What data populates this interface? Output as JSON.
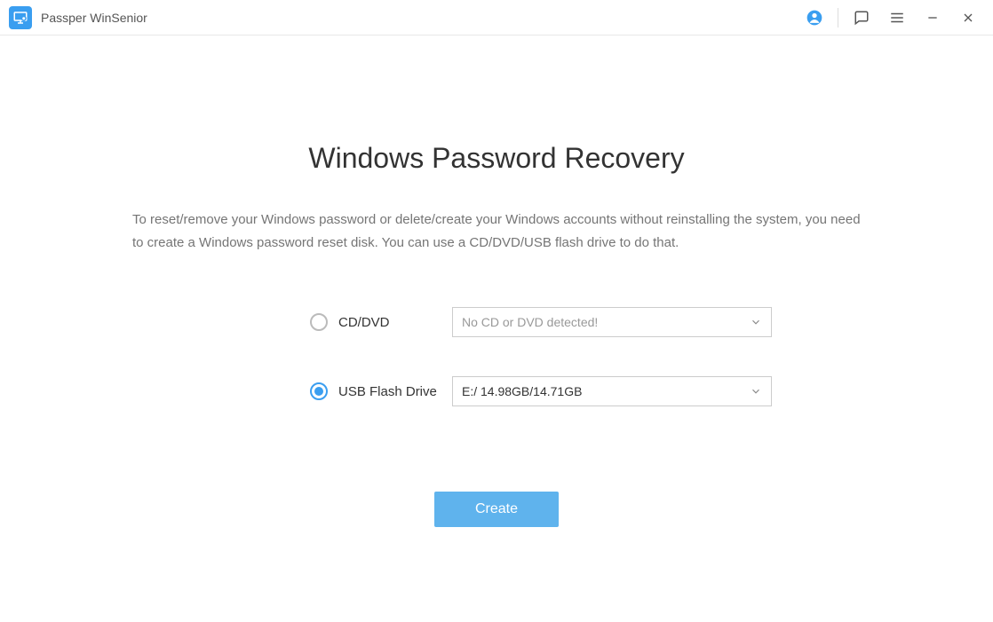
{
  "titlebar": {
    "appName": "Passper WinSenior"
  },
  "main": {
    "title": "Windows Password Recovery",
    "description": "To reset/remove your Windows password or delete/create your Windows accounts without reinstalling the system, you need to create a Windows password reset disk. You can use a CD/DVD/USB flash drive to do that.",
    "options": {
      "cddvd": {
        "label": "CD/DVD",
        "selected": false,
        "dropdownText": "No CD or DVD detected!",
        "isPlaceholder": true
      },
      "usb": {
        "label": "USB Flash Drive",
        "selected": true,
        "dropdownText": "E:/ 14.98GB/14.71GB",
        "isPlaceholder": false
      }
    },
    "createButton": "Create"
  }
}
